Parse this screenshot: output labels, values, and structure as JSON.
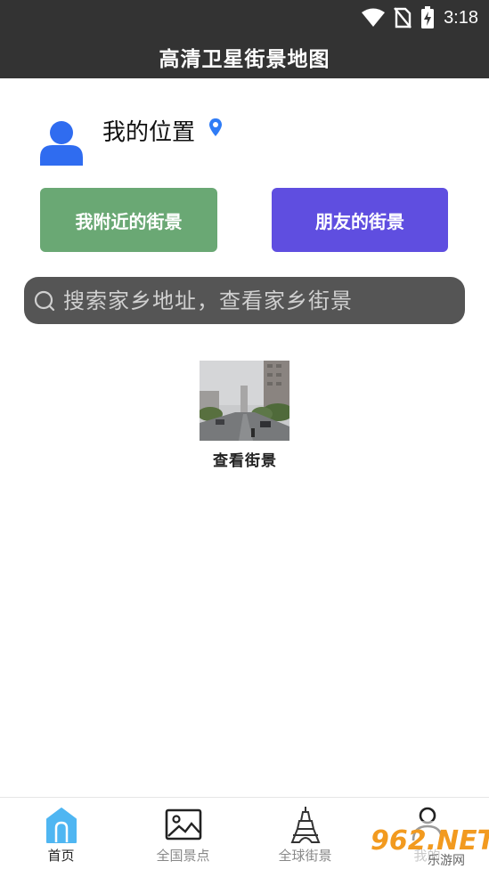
{
  "status_bar": {
    "time": "3:18",
    "icons": [
      "wifi-icon",
      "no-sim-icon",
      "battery-charging-icon"
    ]
  },
  "header": {
    "title": "高清卫星街景地图"
  },
  "location": {
    "label": "我的位置",
    "icon": "location-pin-icon",
    "pin_color": "#2f7cf6"
  },
  "actions": {
    "nearby_label": "我附近的街景",
    "friends_label": "朋友的街景",
    "nearby_color": "#6aa874",
    "friends_color": "#5f4ee0"
  },
  "search": {
    "placeholder": "搜索家乡地址，查看家乡街景"
  },
  "street_view": {
    "caption": "查看街景"
  },
  "tabs": [
    {
      "label": "首页",
      "icon": "home-icon",
      "active": true
    },
    {
      "label": "全国景点",
      "icon": "picture-icon",
      "active": false
    },
    {
      "label": "全球街景",
      "icon": "eiffel-tower-icon",
      "active": false
    },
    {
      "label": "我的",
      "icon": "user-icon",
      "active": false
    }
  ],
  "watermark": {
    "brand": "962.NET",
    "subtitle": "乐游网"
  }
}
